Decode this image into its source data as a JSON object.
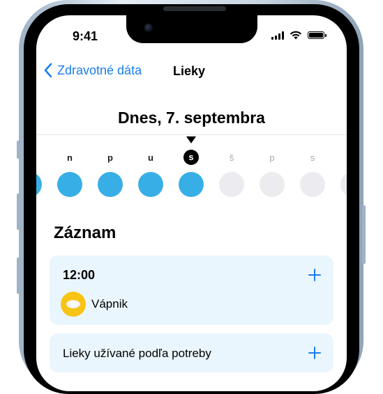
{
  "status": {
    "time": "9:41"
  },
  "nav": {
    "back_label": "Zdravotné dáta",
    "title": "Lieky"
  },
  "date_heading": "Dnes, 7. septembra",
  "week": {
    "days": [
      {
        "label": "",
        "state": "done"
      },
      {
        "label": "n",
        "state": "done"
      },
      {
        "label": "p",
        "state": "done"
      },
      {
        "label": "u",
        "state": "done"
      },
      {
        "label": "s",
        "state": "today"
      },
      {
        "label": "š",
        "state": "future"
      },
      {
        "label": "p",
        "state": "future"
      },
      {
        "label": "s",
        "state": "future"
      },
      {
        "label": "",
        "state": "future"
      }
    ],
    "colors": {
      "done": "#38aee6",
      "empty": "#ececf0"
    }
  },
  "log": {
    "section_title": "Záznam",
    "scheduled": {
      "time": "12:00",
      "medication": "Vápnik"
    },
    "as_needed_label": "Lieky užívané podľa potreby"
  },
  "colors": {
    "accent": "#1a7df2",
    "card_bg": "#eaf6fd",
    "pill_badge": "#f7c414"
  },
  "icons": {
    "back": "chevron-left-icon",
    "signal": "cellular-signal-icon",
    "wifi": "wifi-icon",
    "battery": "battery-icon",
    "add": "plus-icon",
    "pill": "pill-icon"
  }
}
